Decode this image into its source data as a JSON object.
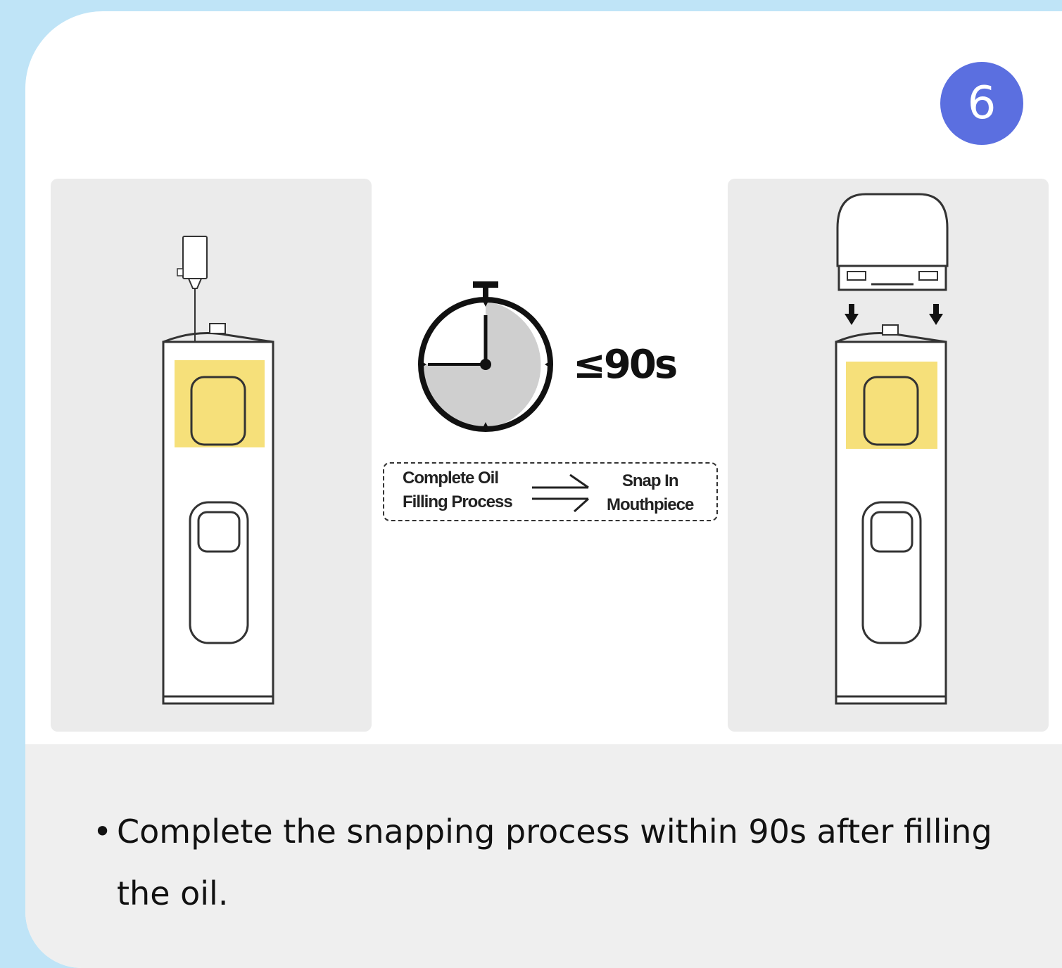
{
  "step": {
    "number": "6"
  },
  "timer": {
    "limit_label": "≤90s"
  },
  "flow": {
    "from_line1": "Complete Oil",
    "from_line2": "Filling Process",
    "to_line1": "Snap In",
    "to_line2": "Mouthpiece"
  },
  "caption": {
    "bullet": "•",
    "text": "Complete the snapping process within 90s after filling the oil."
  },
  "colors": {
    "badge": "#5b6fe0",
    "highlight": "#f6e07a",
    "panel": "#ebebeb",
    "background": "#bfe4f7"
  }
}
